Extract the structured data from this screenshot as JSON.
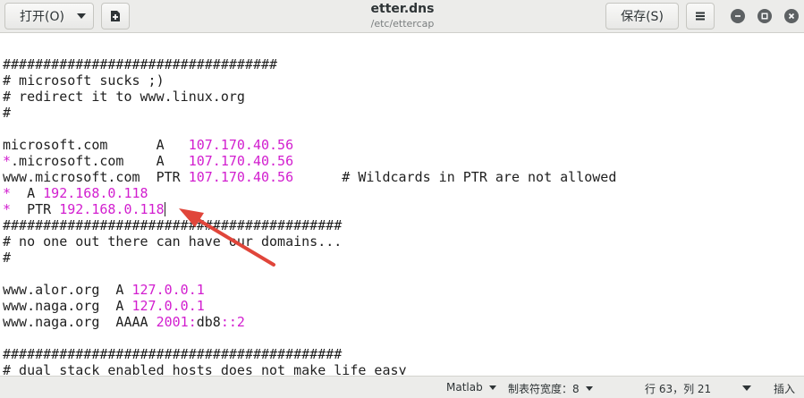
{
  "header": {
    "open_label": "打开(O)",
    "title": "etter.dns",
    "subtitle": "/etc/ettercap",
    "save_label": "保存(S)"
  },
  "icons": {
    "open_dropdown": "chevron-down-icon",
    "new_tab": "new-document-icon",
    "menu": "hamburger-menu-icon",
    "minimize": "minimize-icon",
    "maximize": "maximize-icon",
    "close": "close-icon",
    "annotation": "red-arrow-annotation"
  },
  "colors": {
    "highlight": "#d21ecf",
    "arrow": "#e0453a"
  },
  "editor": {
    "lines": [
      [
        {
          "t": "##################################"
        }
      ],
      [
        {
          "t": "# microsoft sucks ;)"
        }
      ],
      [
        {
          "t": "# redirect it to www.linux.org"
        }
      ],
      [
        {
          "t": "#"
        }
      ],
      [
        {
          "t": ""
        }
      ],
      [
        {
          "t": "microsoft.com      A   "
        },
        {
          "t": "107.170.40.56",
          "c": "m"
        }
      ],
      [
        {
          "t": "*",
          "c": "m"
        },
        {
          "t": ".microsoft.com    A   "
        },
        {
          "t": "107.170.40.56",
          "c": "m"
        }
      ],
      [
        {
          "t": "www.microsoft.com  PTR "
        },
        {
          "t": "107.170.40.56",
          "c": "m"
        },
        {
          "t": "      # Wildcards in PTR are not allowed"
        }
      ],
      [
        {
          "t": "*",
          "c": "m"
        },
        {
          "t": "  A "
        },
        {
          "t": "192.168.0.118",
          "c": "m"
        }
      ],
      [
        {
          "t": "*",
          "c": "m"
        },
        {
          "t": "  PTR "
        },
        {
          "t": "192.168.0.118",
          "c": "m"
        },
        {
          "cursor": true
        }
      ],
      [
        {
          "t": "##########################################"
        }
      ],
      [
        {
          "t": "# no one out there can have our domains..."
        }
      ],
      [
        {
          "t": "#"
        }
      ],
      [
        {
          "t": ""
        }
      ],
      [
        {
          "t": "www.alor.org  A "
        },
        {
          "t": "127.0.0.1",
          "c": "m"
        }
      ],
      [
        {
          "t": "www.naga.org  A "
        },
        {
          "t": "127.0.0.1",
          "c": "m"
        }
      ],
      [
        {
          "t": "www.naga.org  AAAA "
        },
        {
          "t": "2001",
          "c": "m"
        },
        {
          "t": ":",
          "c": "m"
        },
        {
          "t": "db8"
        },
        {
          "t": "::",
          "c": "m"
        },
        {
          "t": "2",
          "c": "m"
        }
      ],
      [
        {
          "t": ""
        }
      ],
      [
        {
          "t": "##########################################"
        }
      ],
      [
        {
          "t": "# dual stack enabled hosts does not make life easy"
        }
      ]
    ]
  },
  "statusbar": {
    "language": "Matlab",
    "tab_width": "制表符宽度：8",
    "position": "行 63，列 21",
    "mode": "插入"
  }
}
